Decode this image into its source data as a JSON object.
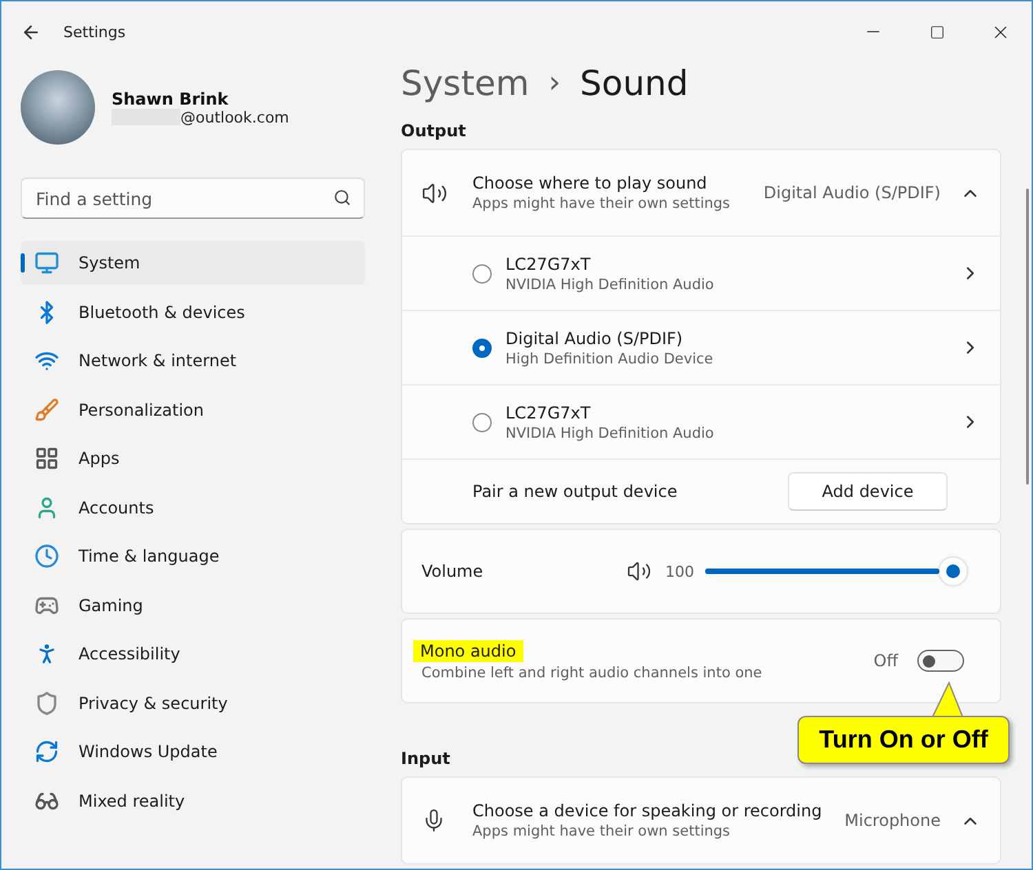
{
  "window": {
    "title": "Settings"
  },
  "user": {
    "name": "Shawn Brink",
    "email": "@outlook.com"
  },
  "search": {
    "placeholder": "Find a setting"
  },
  "sidebar": {
    "items": [
      {
        "label": "System",
        "selected": true
      },
      {
        "label": "Bluetooth & devices",
        "selected": false
      },
      {
        "label": "Network & internet",
        "selected": false
      },
      {
        "label": "Personalization",
        "selected": false
      },
      {
        "label": "Apps",
        "selected": false
      },
      {
        "label": "Accounts",
        "selected": false
      },
      {
        "label": "Time & language",
        "selected": false
      },
      {
        "label": "Gaming",
        "selected": false
      },
      {
        "label": "Accessibility",
        "selected": false
      },
      {
        "label": "Privacy & security",
        "selected": false
      },
      {
        "label": "Windows Update",
        "selected": false
      },
      {
        "label": "Mixed reality",
        "selected": false
      }
    ]
  },
  "breadcrumb": {
    "parent": "System",
    "separator": "›",
    "current": "Sound"
  },
  "output": {
    "heading": "Output",
    "title": "Choose where to play sound",
    "subtitle": "Apps might have their own settings",
    "value": "Digital Audio (S/PDIF)",
    "expanded": true,
    "devices": [
      {
        "name": "LC27G7xT",
        "driver": "NVIDIA High Definition Audio",
        "selected": false
      },
      {
        "name": "Digital Audio (S/PDIF)",
        "driver": "High Definition Audio Device",
        "selected": true
      },
      {
        "name": "LC27G7xT",
        "driver": "NVIDIA High Definition Audio",
        "selected": false
      }
    ],
    "pair_label": "Pair a new output device",
    "pair_button": "Add device"
  },
  "volume": {
    "label": "Volume",
    "reading": "100",
    "level": 1.0
  },
  "mono": {
    "title": "Mono audio",
    "subtitle": "Combine left and right audio channels into one",
    "state_label": "Off",
    "on": false
  },
  "callout": {
    "text": "Turn On or Off"
  },
  "input": {
    "heading": "Input",
    "title": "Choose a device for speaking or recording",
    "subtitle": "Apps might have their own settings",
    "value": "Microphone",
    "expanded": true
  }
}
